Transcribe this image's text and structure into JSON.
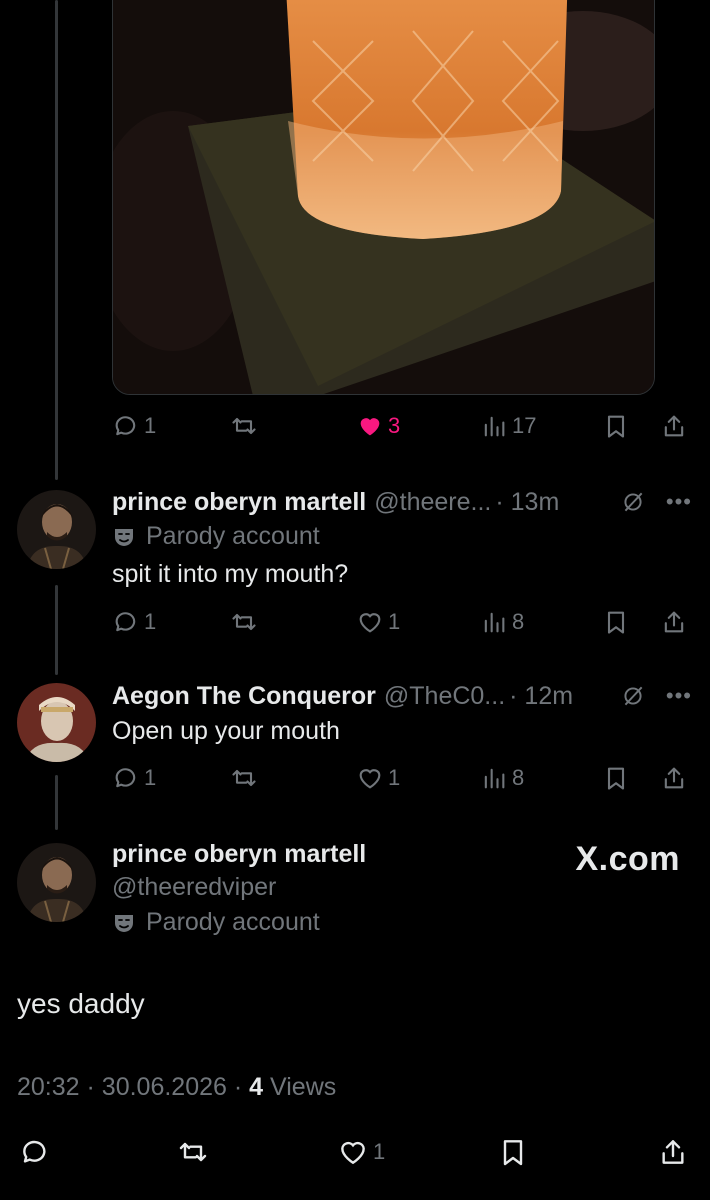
{
  "photo": {
    "description_icon": "image"
  },
  "post0": {
    "stats": {
      "replies": "1",
      "reposts": "",
      "likes": "3",
      "views": "17"
    }
  },
  "post1": {
    "name": "prince oberyn martell",
    "handle": "@theere...",
    "time": "· 13m",
    "parody_label": "Parody account",
    "text": "spit it into my mouth?",
    "stats": {
      "replies": "1",
      "likes": "1",
      "views": "8"
    }
  },
  "post2": {
    "name": "Aegon The Conqueror",
    "handle": "@TheC0...",
    "time": "· 12m",
    "text": "Open up your mouth",
    "stats": {
      "replies": "1",
      "likes": "1",
      "views": "8"
    }
  },
  "main": {
    "name": "prince oberyn martell",
    "handle": "@theeredviper",
    "parody_label": "Parody account",
    "text": "yes daddy",
    "time": "20:32",
    "date": "30.06.2026",
    "views_count": "4",
    "views_label": "Views",
    "stats": {
      "likes": "1"
    }
  },
  "watermark": "X.com",
  "colors": {
    "background": "#000000",
    "text": "#e7e9ea",
    "muted": "#71767b",
    "like": "#f91880",
    "thread": "#333639"
  }
}
